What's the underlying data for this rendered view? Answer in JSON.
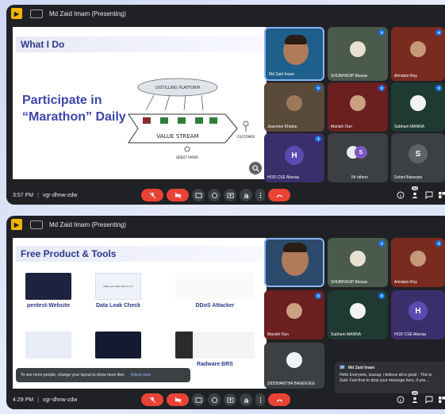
{
  "window1": {
    "title": "Md Zaid Imam (Presenting)",
    "slide": {
      "title": "What I Do",
      "line1": "Participate in",
      "line2": "“Marathon” Daily",
      "sketch_cloud": "DISTILLING PLATFORM",
      "sketch_arrow": "VALUE STREAM",
      "sketch_right": "CUSTOMER",
      "sketch_bottom": "DEBUT PAPER"
    },
    "tiles": [
      {
        "name": "Md Zaid Imam",
        "initial": ""
      },
      {
        "name": "SHUBHADIP Biswas",
        "initial": ""
      },
      {
        "name": "Arindam Roy",
        "initial": ""
      },
      {
        "name": "Jeannine Khatun",
        "initial": ""
      },
      {
        "name": "Manish Oun",
        "initial": ""
      },
      {
        "name": "Subham MANNA",
        "initial": ""
      },
      {
        "name": "HOD CSE Aberaa",
        "initial": "H"
      },
      {
        "name": "54 others",
        "initial": "S"
      },
      {
        "name": "Sohini Banerjee",
        "initial": "S"
      }
    ],
    "time": "3:57 PM",
    "code": "vgr-dhnw-zdw",
    "participants_badge": "63"
  },
  "window2": {
    "title": "Md Zaid Imam (Presenting)",
    "slide": {
      "title": "Free Product & Tools",
      "card1": "pentest-Website",
      "card2": "Data Leak Check",
      "card3": "DDoS Attacker",
      "card4": "Radware BRS",
      "card2_thumb": "Make your data safe for you"
    },
    "tiles": [
      {
        "name": "",
        "initial": ""
      },
      {
        "name": "SHUBHADIP Biswas",
        "initial": ""
      },
      {
        "name": "Arindam Roy",
        "initial": ""
      },
      {
        "name": "Manish Oun",
        "initial": ""
      },
      {
        "name": "Subham MANNA",
        "initial": ""
      },
      {
        "name": "HOD CSE Aberaa",
        "initial": "H"
      },
      {
        "name": "SIDDHARTHA BANERJEE",
        "initial": ""
      }
    ],
    "toast": {
      "text": "To see more people, change your layout to show more tiles",
      "action": "Adjust view"
    },
    "chat": {
      "sender": "Md Zaid Imam",
      "message": "Hello Everyone, ssssup, i believe all is good - This is Zaid- Feel free to drop your message here, if you ..."
    },
    "time": "4:29 PM",
    "code": "vgr-dhnw-zdw",
    "participants_badge": "63"
  },
  "colors": {
    "meet_dark": "#202124",
    "tile": "#3c4043",
    "end_call": "#ea4335",
    "slide_title": "#2d3a8c",
    "accent_blue": "#1a73e8"
  },
  "icons": [
    "meet-logo-icon",
    "present-icon",
    "mic-off-icon",
    "camera-off-icon",
    "captions-icon",
    "emoji-icon",
    "present-now-icon",
    "raise-hand-icon",
    "more-icon",
    "end-call-icon",
    "info-icon",
    "people-icon",
    "chat-icon",
    "activities-icon",
    "zoom-icon"
  ]
}
